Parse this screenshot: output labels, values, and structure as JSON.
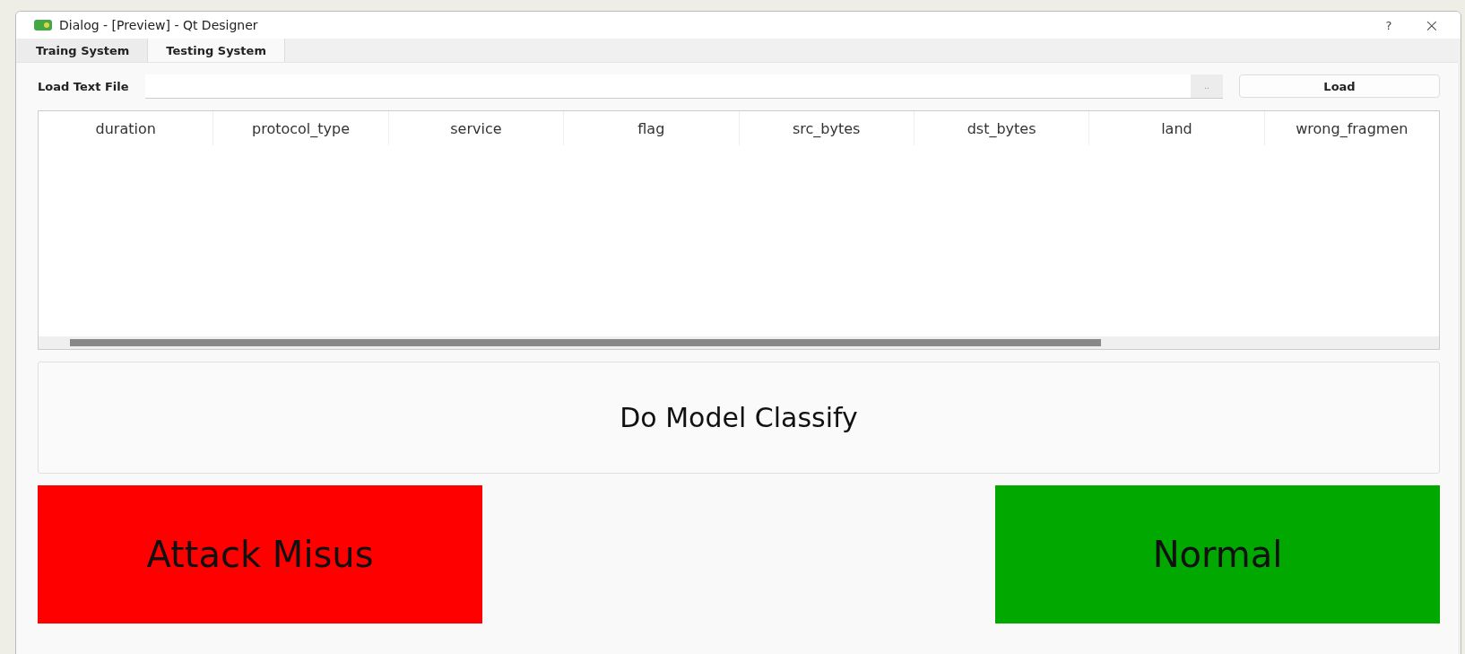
{
  "window": {
    "title": "Dialog - [Preview] - Qt Designer",
    "help": "?",
    "close": "×"
  },
  "tabs": [
    {
      "label": "Traing System",
      "selected": false
    },
    {
      "label": "Testing System",
      "selected": true
    }
  ],
  "load_row": {
    "label": "Load Text File",
    "browse": "..",
    "button": "Load"
  },
  "table": {
    "columns": [
      "duration",
      "protocol_type",
      "service",
      "flag",
      "src_bytes",
      "dst_bytes",
      "land",
      "wrong_fragmen"
    ]
  },
  "classify_button": "Do Model Classify",
  "results": [
    {
      "label": "Attack Misus",
      "color": "#ff0000"
    },
    {
      "label": "Normal",
      "color": "#00a800"
    }
  ]
}
